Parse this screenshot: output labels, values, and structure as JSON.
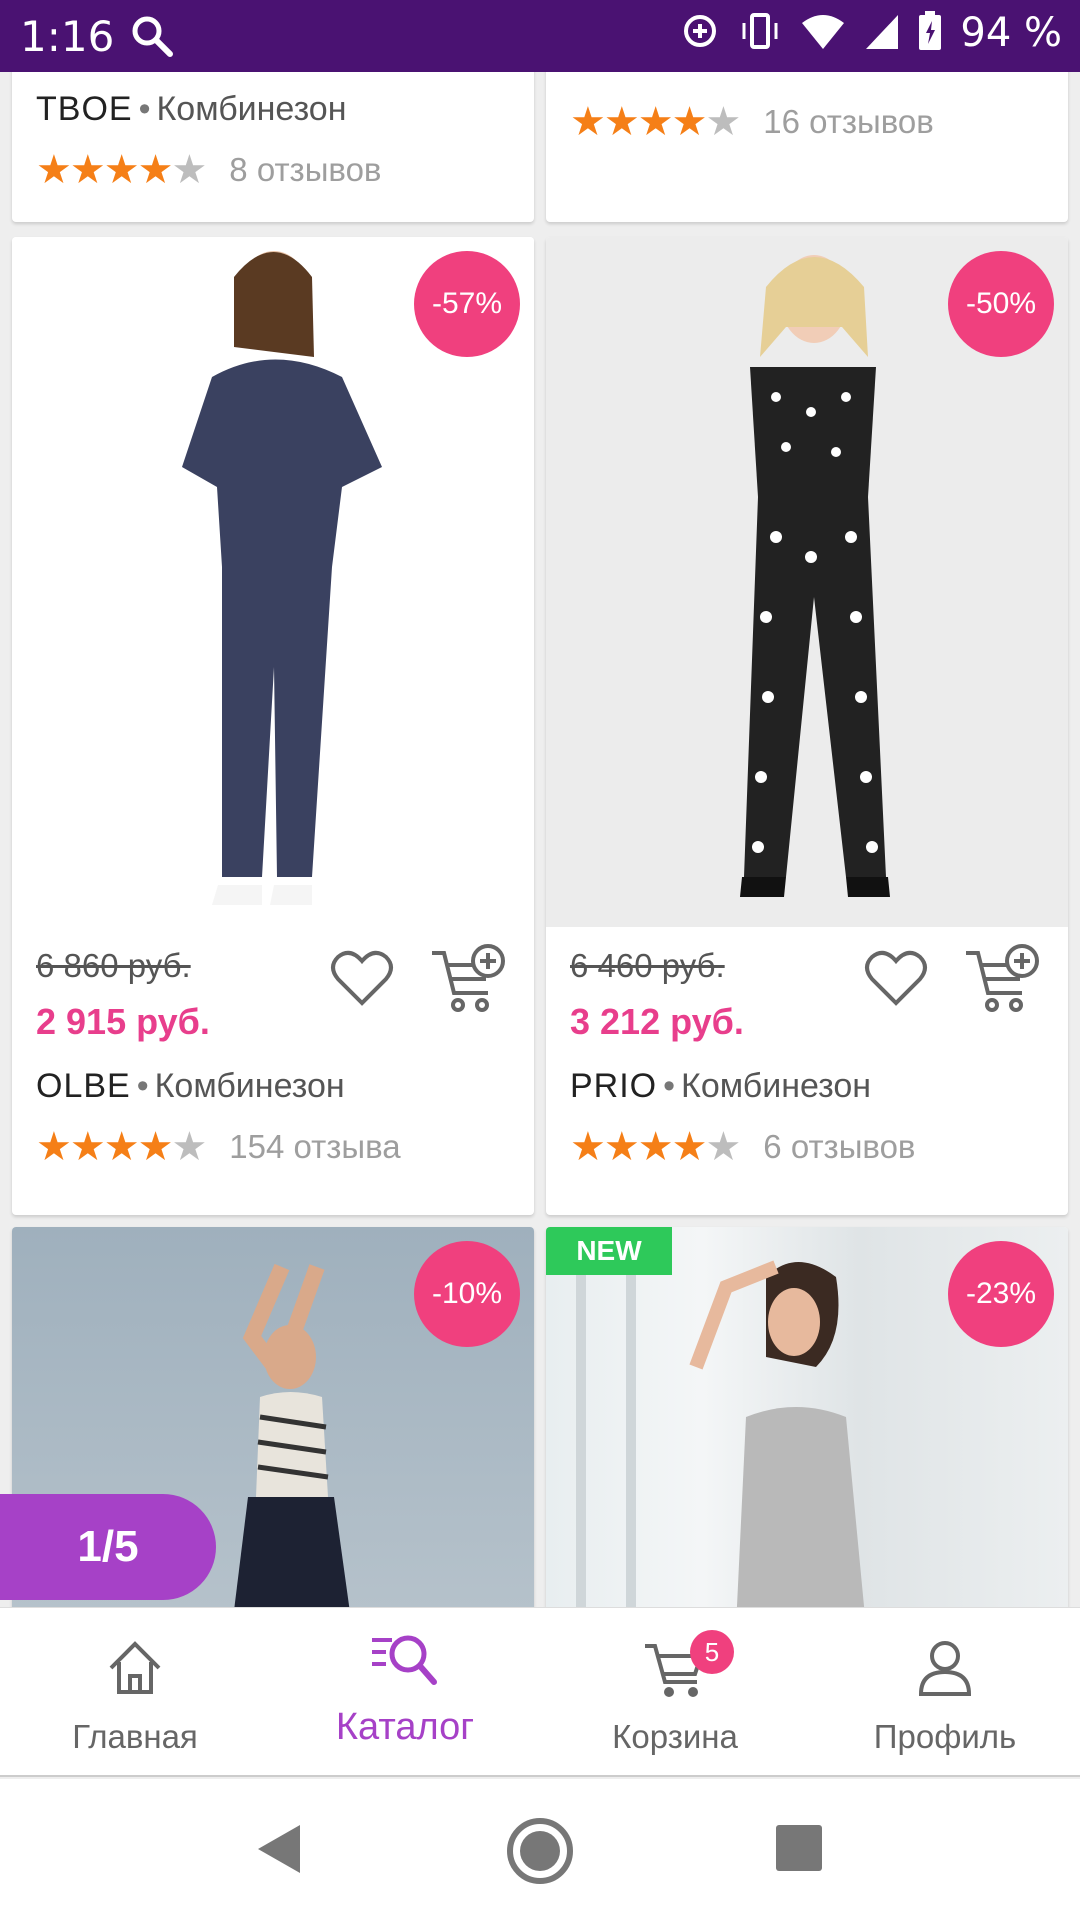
{
  "status_bar": {
    "time": "1:16",
    "battery_text": "94 %",
    "icons": [
      "search-icon",
      "sync-icon",
      "vibrate-icon",
      "wifi-icon",
      "signal-icon",
      "battery-icon"
    ]
  },
  "colors": {
    "status_bar": "#4a1272",
    "accent": "#a641c7",
    "price": "#e83e8c",
    "discount_badge": "#f0407e",
    "new_badge": "#2ec95a",
    "star": "#f57f17"
  },
  "products": [
    {
      "brand": "TBOE",
      "type": "Комбинезон",
      "rating": 4,
      "reviews": "8 отзывов"
    },
    {
      "rating": 4,
      "reviews": "16 отзывов"
    },
    {
      "discount": "-57%",
      "old_price": "6 860 руб.",
      "price": "2 915 руб.",
      "brand": "OLBE",
      "type": "Комбинезон",
      "rating": 4,
      "reviews": "154 отзыва"
    },
    {
      "discount": "-50%",
      "old_price": "6 460 руб.",
      "price": "3 212 руб.",
      "brand": "PRIO",
      "type": "Комбинезон",
      "rating": 4,
      "reviews": "6 отзывов"
    },
    {
      "discount": "-10%"
    },
    {
      "badge": "NEW",
      "discount": "-23%"
    }
  ],
  "pager": "1/5",
  "bottom_nav": {
    "items": [
      {
        "label": "Главная",
        "icon": "home-icon"
      },
      {
        "label": "Каталог",
        "icon": "catalog-search-icon",
        "active": true
      },
      {
        "label": "Корзина",
        "icon": "cart-icon",
        "badge": "5"
      },
      {
        "label": "Профиль",
        "icon": "profile-icon"
      }
    ]
  },
  "system_nav": [
    "back-icon",
    "home-icon",
    "recents-icon"
  ]
}
